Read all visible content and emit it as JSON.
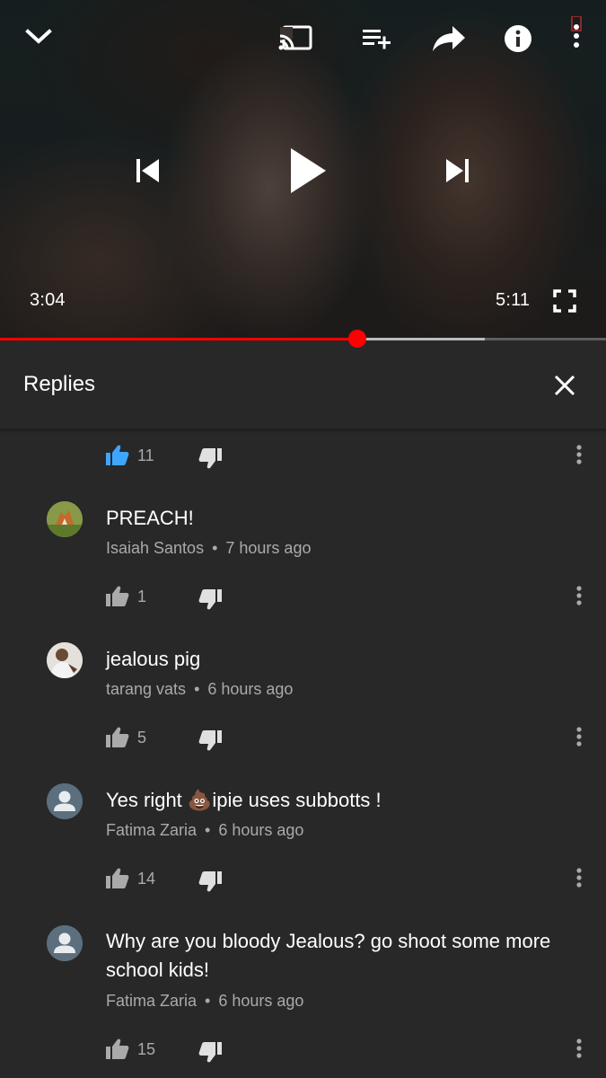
{
  "player": {
    "elapsed": "3:04",
    "duration": "5:11",
    "progress_played": 0.59,
    "progress_buffered": 0.8
  },
  "replies": {
    "title": "Replies"
  },
  "top_reply_actions": {
    "likes": "11"
  },
  "comments": [
    {
      "text": "PREACH!",
      "author": "Isaiah Santos",
      "time": "7 hours ago",
      "likes": "1"
    },
    {
      "text": "jealous pig",
      "author": "tarang vats",
      "time": "6 hours ago",
      "likes": "5"
    },
    {
      "text_before": "Yes right ",
      "emoji": "💩",
      "text_after": "ipie uses subbotts !",
      "author": "Fatima Zaria",
      "time": "6 hours ago",
      "likes": "14"
    },
    {
      "text": "Why are you bloody Jealous? go shoot some more school kids!",
      "author": "Fatima Zaria",
      "time": "6 hours ago",
      "likes": "15"
    }
  ],
  "colors": {
    "background": "#282828",
    "progress_red": "#ff0000",
    "liked_blue": "#3ea6ff",
    "secondary_text": "#aaaaaa"
  }
}
